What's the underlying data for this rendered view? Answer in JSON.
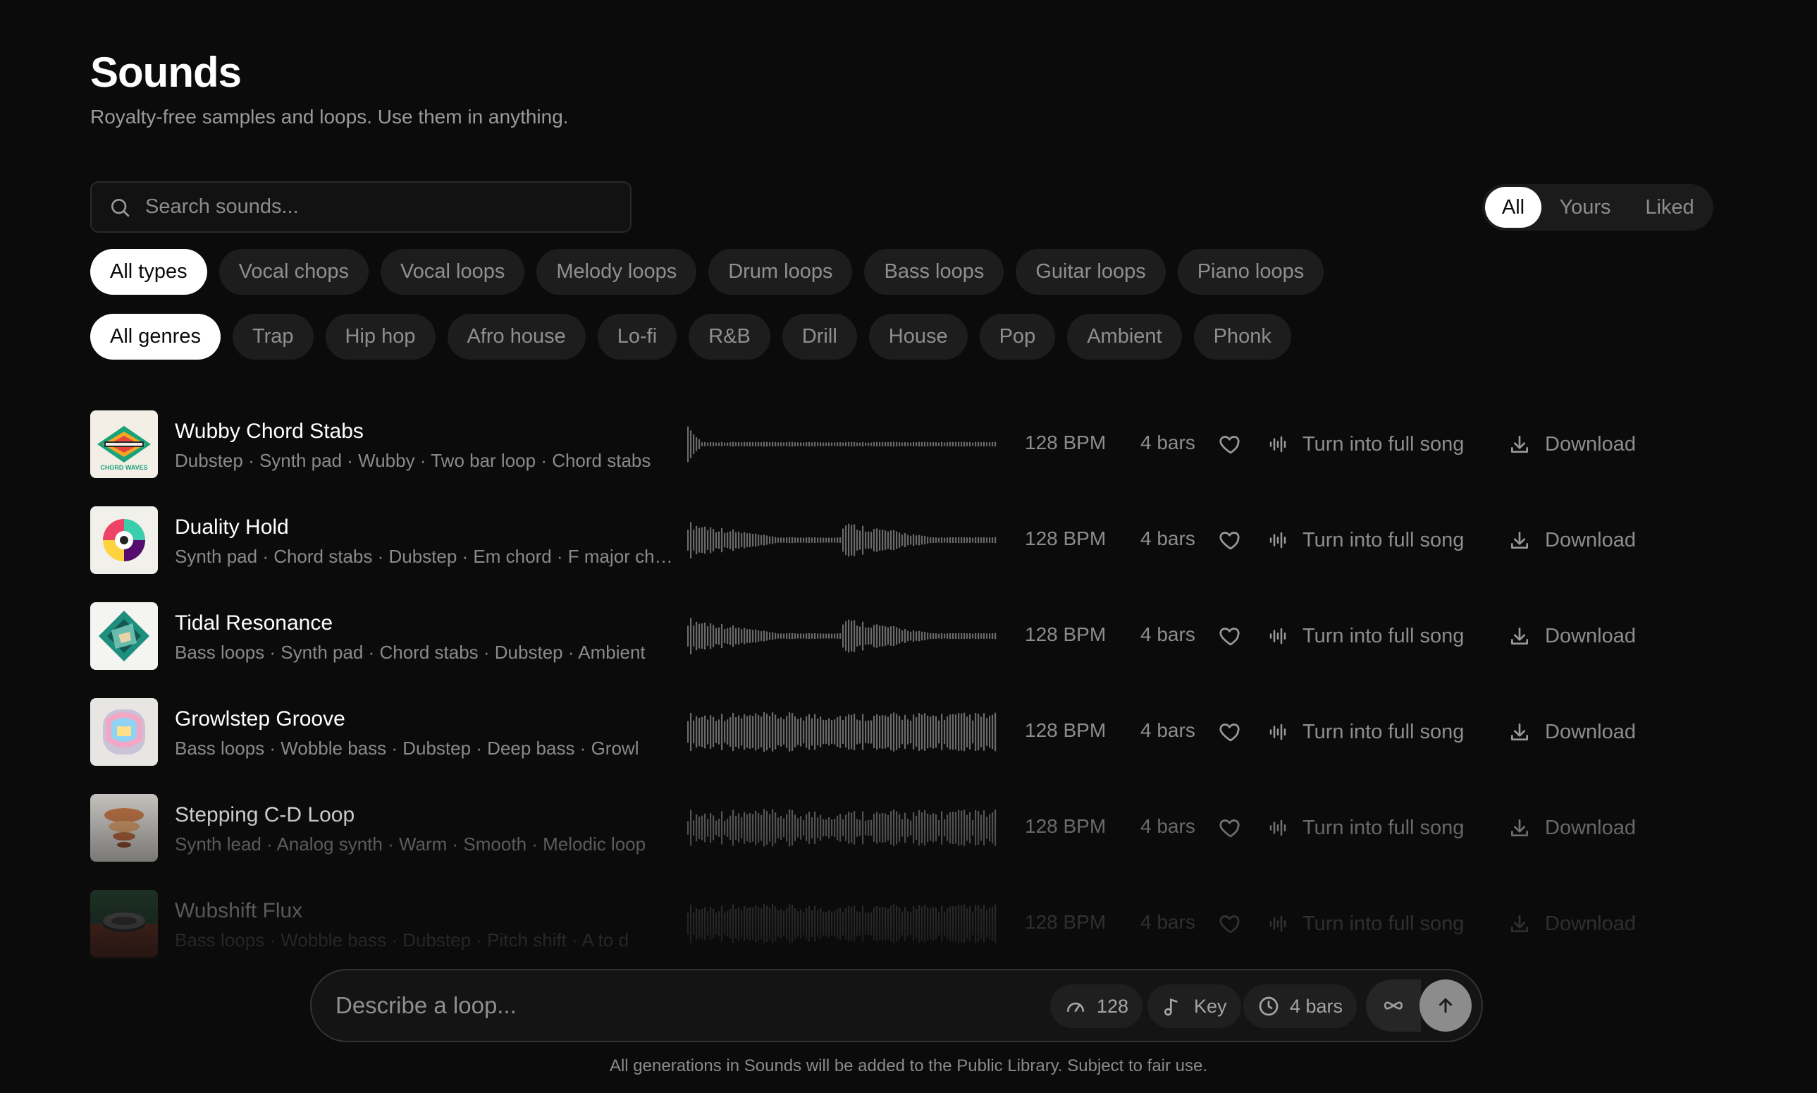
{
  "header": {
    "title": "Sounds",
    "subtitle": "Royalty-free samples and loops. Use them in anything."
  },
  "search": {
    "placeholder": "Search sounds...",
    "icon": "search-icon"
  },
  "scope_tabs": [
    {
      "label": "All",
      "active": true
    },
    {
      "label": "Yours",
      "active": false
    },
    {
      "label": "Liked",
      "active": false
    }
  ],
  "type_filters": [
    {
      "label": "All types",
      "active": true
    },
    {
      "label": "Vocal chops",
      "active": false
    },
    {
      "label": "Vocal loops",
      "active": false
    },
    {
      "label": "Melody loops",
      "active": false
    },
    {
      "label": "Drum loops",
      "active": false
    },
    {
      "label": "Bass loops",
      "active": false
    },
    {
      "label": "Guitar loops",
      "active": false
    },
    {
      "label": "Piano loops",
      "active": false
    }
  ],
  "genre_filters": [
    {
      "label": "All genres",
      "active": true
    },
    {
      "label": "Trap",
      "active": false
    },
    {
      "label": "Hip hop",
      "active": false
    },
    {
      "label": "Afro house",
      "active": false
    },
    {
      "label": "Lo-fi",
      "active": false
    },
    {
      "label": "R&B",
      "active": false
    },
    {
      "label": "Drill",
      "active": false
    },
    {
      "label": "House",
      "active": false
    },
    {
      "label": "Pop",
      "active": false
    },
    {
      "label": "Ambient",
      "active": false
    },
    {
      "label": "Phonk",
      "active": false
    }
  ],
  "sounds": [
    {
      "name": "Wubby Chord Stabs",
      "tags": "Dubstep · Synth pad · Wubby · Two bar loop · Chord stabs",
      "bpm": "128 BPM",
      "bars": "4 bars",
      "action": "Turn into full song",
      "download": "Download",
      "thumb_text": "CHORD WAVES",
      "wave": "spike"
    },
    {
      "name": "Duality Hold",
      "tags": "Synth pad · Chord stabs · Dubstep · Em chord · F major chord",
      "bpm": "128 BPM",
      "bars": "4 bars",
      "action": "Turn into full song",
      "download": "Download",
      "thumb_text": "",
      "wave": "double"
    },
    {
      "name": "Tidal Resonance",
      "tags": "Bass loops · Synth pad · Chord stabs · Dubstep · Ambient",
      "bpm": "128 BPM",
      "bars": "4 bars",
      "action": "Turn into full song",
      "download": "Download",
      "thumb_text": "",
      "wave": "double"
    },
    {
      "name": "Growlstep Groove",
      "tags": "Bass loops · Wobble bass · Dubstep · Deep bass · Growl",
      "bpm": "128 BPM",
      "bars": "4 bars",
      "action": "Turn into full song",
      "download": "Download",
      "thumb_text": "",
      "wave": "dense"
    },
    {
      "name": "Stepping C-D Loop",
      "tags": "Synth lead · Analog synth · Warm · Smooth · Melodic loop",
      "bpm": "128 BPM",
      "bars": "4 bars",
      "action": "Turn into full song",
      "download": "Download",
      "thumb_text": "",
      "wave": "varied"
    },
    {
      "name": "Wubshift Flux",
      "tags": "Bass loops · Wobble bass · Dubstep · Pitch shift · A to d",
      "bpm": "128 BPM",
      "bars": "4 bars",
      "action": "Turn into full song",
      "download": "Download",
      "thumb_text": "",
      "wave": "dense"
    }
  ],
  "composer": {
    "placeholder": "Describe a loop...",
    "bpm": "128",
    "key": "Key",
    "bars": "4 bars"
  },
  "footnote": "All generations in Sounds will be added to the Public Library. Subject to fair use."
}
